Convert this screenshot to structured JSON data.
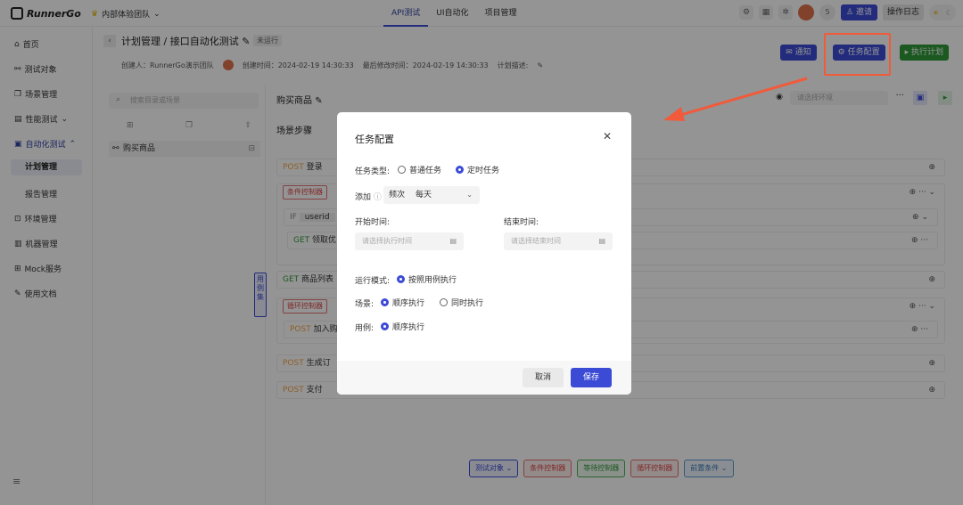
{
  "topbar": {
    "logo": "RunnerGo",
    "team": "内部体验团队",
    "nav": [
      "API测试",
      "UI自动化",
      "项目管理"
    ],
    "count": "5",
    "invite": "邀请",
    "log": "操作日志"
  },
  "sidebar": {
    "items": [
      "首页",
      "测试对象",
      "场景管理",
      "性能测试",
      "自动化测试",
      "计划管理",
      "报告管理",
      "环境管理",
      "机器管理",
      "Mock服务",
      "使用文档"
    ]
  },
  "header": {
    "breadcrumb": "计划管理 / 接口自动化测试",
    "status": "未运行",
    "creator": "创建人：RunnerGo演示团队",
    "created": "创建时间：2024-02-19 14:30:33",
    "modified": "最后修改时间：2024-02-19 14:30:33",
    "desc": "计划描述:",
    "notify": "通知",
    "task_config": "任务配置",
    "run_plan": "执行计划"
  },
  "tree": {
    "search_placeholder": "搜索目录或场景",
    "node": "购买商品",
    "handle": "用例集"
  },
  "main": {
    "scene_title": "购买商品",
    "env_placeholder": "请选择环境",
    "steps_title": "场景步骤",
    "rows": [
      {
        "method": "POST",
        "name": "登录"
      },
      {
        "tag": "条件控制器"
      },
      {
        "if": "IF",
        "param": "userid"
      },
      {
        "method": "GET",
        "name": "领取优"
      },
      {
        "method": "GET",
        "name": "商品列表"
      },
      {
        "tag": "循环控制器"
      },
      {
        "method": "POST",
        "name": "加入购"
      },
      {
        "method": "POST",
        "name": "生成订"
      },
      {
        "method": "POST",
        "name": "支付"
      }
    ],
    "bottom_buttons": [
      "测试对象",
      "条件控制器",
      "等待控制器",
      "循环控制器",
      "前置条件"
    ]
  },
  "modal": {
    "title": "任务配置",
    "task_type_label": "任务类型:",
    "task_type_options": [
      "普通任务",
      "定时任务"
    ],
    "add_label": "添加",
    "freq_label": "频次",
    "freq_value": "每天",
    "start_label": "开始时间:",
    "end_label": "结束时间:",
    "start_placeholder": "请选择执行时间",
    "end_placeholder": "请选择结束时间",
    "run_mode_label": "运行模式:",
    "run_mode_option": "按照用例执行",
    "scene_label": "场景:",
    "scene_options": [
      "顺序执行",
      "同时执行"
    ],
    "case_label": "用例:",
    "case_option": "顺序执行",
    "cancel": "取消",
    "save": "保存"
  }
}
